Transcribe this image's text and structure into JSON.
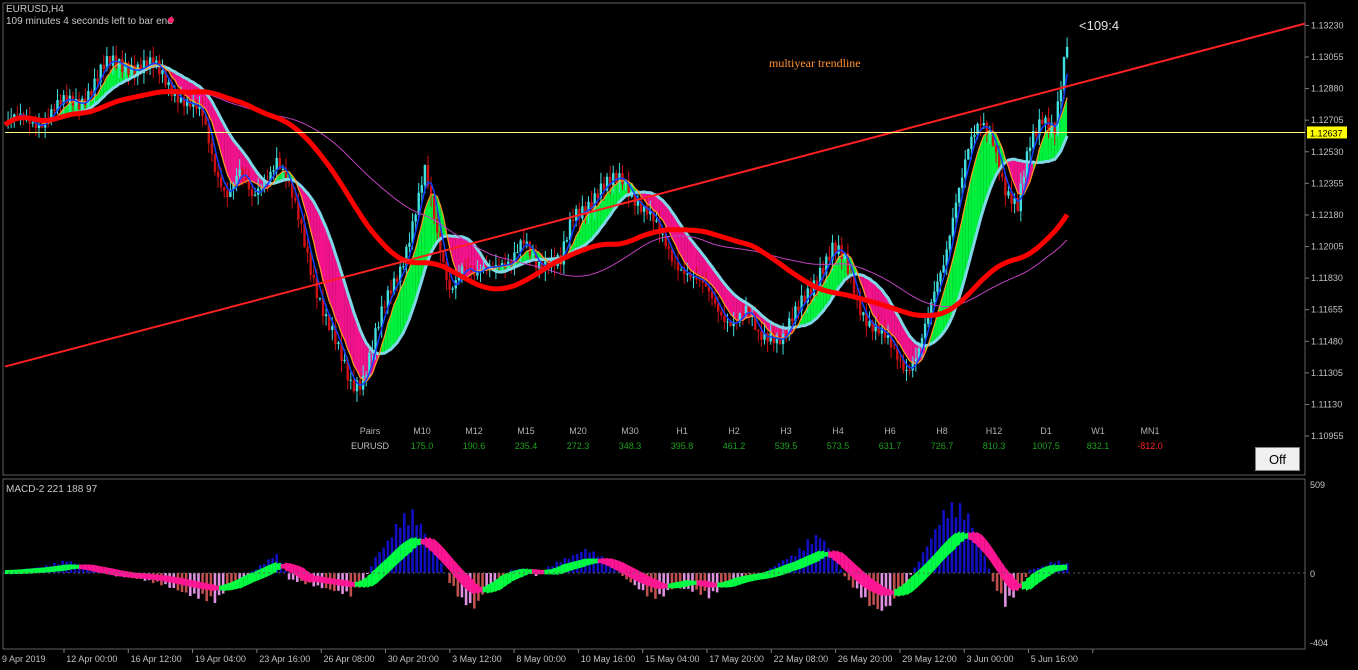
{
  "window": {
    "symbol_tf": "EURUSD,H4",
    "countdown_text": "109 minutes 4 seconds left to bar end",
    "bar_timer": "<109:4"
  },
  "annotation": {
    "trendline_label": "multiyear trendline"
  },
  "price_axis": {
    "ticks": [
      "1.13230",
      "1.13055",
      "1.12880",
      "1.12705",
      "1.12530",
      "1.12355",
      "1.12180",
      "1.12005",
      "1.11830",
      "1.11655",
      "1.11480",
      "1.11305",
      "1.11130",
      "1.10955"
    ],
    "current_price": "1.12637"
  },
  "time_axis": {
    "labels": [
      "9 Apr 2019",
      "12 Apr 00:00",
      "16 Apr 12:00",
      "19 Apr 04:00",
      "23 Apr 16:00",
      "26 Apr 08:00",
      "30 Apr 20:00",
      "3 May 12:00",
      "8 May 00:00",
      "10 May 16:00",
      "15 May 04:00",
      "17 May 20:00",
      "22 May 08:00",
      "26 May 20:00",
      "29 May 12:00",
      "3 Jun 00:00",
      "5 Jun 16:00"
    ]
  },
  "strength_table": {
    "header": [
      "Pairs",
      "M10",
      "M12",
      "M15",
      "M20",
      "M30",
      "H1",
      "H2",
      "H3",
      "H4",
      "H6",
      "H8",
      "H12",
      "D1",
      "W1",
      "MN1"
    ],
    "row_label": "EURUSD",
    "values": [
      "175.0",
      "190.6",
      "235.4",
      "272.3",
      "348.3",
      "395.8",
      "461.2",
      "539.5",
      "573.5",
      "631.7",
      "726.7",
      "810.3",
      "1007.5",
      "832.1",
      "-812.0"
    ]
  },
  "indicator": {
    "title": "MACD-2 221 188 97",
    "scale_top": "509",
    "scale_zero": "0",
    "scale_bottom": "-404"
  },
  "buttons": {
    "off_label": "Off"
  },
  "colors": {
    "background": "#000000",
    "bull_candle": "#40e0e0",
    "bear_candle": "#d01010",
    "bull_cloud": "#00ff40",
    "bear_cloud": "#ff1493",
    "ma_slow": "#ff0000",
    "trendline": "#ff2020",
    "price_line": "#ffff80",
    "macd_pos": "#1010c0",
    "macd_neg": "#c05050",
    "macd_signal_up": "#00ff40",
    "macd_signal_down": "#ff1493"
  },
  "chart_data": {
    "type": "candlestick",
    "symbol": "EURUSD",
    "timeframe": "H4",
    "ylim": [
      1.1085,
      1.1326
    ],
    "current_price": 1.12637,
    "close_path": [
      [
        0,
        1.1268
      ],
      [
        3,
        1.1272
      ],
      [
        6,
        1.1282
      ],
      [
        8,
        1.1298
      ],
      [
        10,
        1.1303
      ],
      [
        12,
        1.1298
      ],
      [
        14,
        1.1287
      ],
      [
        16,
        1.127
      ],
      [
        17,
        1.1245
      ],
      [
        18,
        1.1232
      ],
      [
        19,
        1.124
      ],
      [
        20,
        1.1225
      ],
      [
        21,
        1.124
      ],
      [
        22,
        1.125
      ],
      [
        23,
        1.123
      ],
      [
        24,
        1.121
      ],
      [
        25,
        1.1185
      ],
      [
        26,
        1.116
      ],
      [
        27,
        1.114
      ],
      [
        28,
        1.1125
      ],
      [
        29,
        1.113
      ],
      [
        30,
        1.115
      ],
      [
        31,
        1.117
      ],
      [
        32,
        1.119
      ],
      [
        33,
        1.1215
      ],
      [
        34,
        1.124
      ],
      [
        35,
        1.1205
      ],
      [
        36,
        1.118
      ],
      [
        37,
        1.119
      ],
      [
        38,
        1.118
      ],
      [
        39,
        1.119
      ],
      [
        40,
        1.1195
      ],
      [
        41,
        1.119
      ],
      [
        42,
        1.12
      ],
      [
        43,
        1.1193
      ],
      [
        44,
        1.1195
      ],
      [
        45,
        1.119
      ],
      [
        46,
        1.1215
      ],
      [
        47,
        1.1225
      ],
      [
        48,
        1.1232
      ],
      [
        49,
        1.1233
      ],
      [
        50,
        1.1237
      ],
      [
        51,
        1.123
      ],
      [
        52,
        1.122
      ],
      [
        53,
        1.1205
      ],
      [
        54,
        1.1195
      ],
      [
        55,
        1.119
      ],
      [
        56,
        1.118
      ],
      [
        57,
        1.1172
      ],
      [
        58,
        1.1165
      ],
      [
        59,
        1.116
      ],
      [
        60,
        1.1162
      ],
      [
        61,
        1.115
      ],
      [
        62,
        1.1155
      ],
      [
        63,
        1.115
      ],
      [
        64,
        1.116
      ],
      [
        65,
        1.1175
      ],
      [
        66,
        1.119
      ],
      [
        67,
        1.1198
      ],
      [
        68,
        1.119
      ],
      [
        69,
        1.1172
      ],
      [
        70,
        1.116
      ],
      [
        71,
        1.115
      ],
      [
        72,
        1.114
      ],
      [
        73,
        1.1135
      ],
      [
        74,
        1.1145
      ],
      [
        75,
        1.1165
      ],
      [
        76,
        1.119
      ],
      [
        77,
        1.123
      ],
      [
        78,
        1.1255
      ],
      [
        79,
        1.1265
      ],
      [
        80,
        1.126
      ],
      [
        81,
        1.1235
      ],
      [
        82,
        1.122
      ],
      [
        83,
        1.1255
      ],
      [
        84,
        1.1275
      ],
      [
        85,
        1.1268
      ],
      [
        86,
        1.131
      ]
    ],
    "macd_hist": [
      [
        0,
        10
      ],
      [
        3,
        40
      ],
      [
        5,
        80
      ],
      [
        7,
        30
      ],
      [
        9,
        -20
      ],
      [
        11,
        -40
      ],
      [
        13,
        -80
      ],
      [
        15,
        -140
      ],
      [
        17,
        -180
      ],
      [
        18,
        -100
      ],
      [
        19,
        -60
      ],
      [
        20,
        10
      ],
      [
        22,
        120
      ],
      [
        23,
        -40
      ],
      [
        25,
        -80
      ],
      [
        27,
        -120
      ],
      [
        28,
        -140
      ],
      [
        29,
        -60
      ],
      [
        30,
        100
      ],
      [
        31,
        200
      ],
      [
        32,
        340
      ],
      [
        33,
        380
      ],
      [
        34,
        260
      ],
      [
        35,
        120
      ],
      [
        36,
        -60
      ],
      [
        37,
        -180
      ],
      [
        38,
        -220
      ],
      [
        39,
        -100
      ],
      [
        40,
        -40
      ],
      [
        41,
        20
      ],
      [
        42,
        30
      ],
      [
        43,
        -20
      ],
      [
        44,
        40
      ],
      [
        45,
        80
      ],
      [
        46,
        110
      ],
      [
        47,
        150
      ],
      [
        48,
        120
      ],
      [
        49,
        60
      ],
      [
        50,
        -20
      ],
      [
        51,
        -80
      ],
      [
        52,
        -140
      ],
      [
        53,
        -160
      ],
      [
        54,
        -100
      ],
      [
        55,
        -100
      ],
      [
        56,
        -120
      ],
      [
        57,
        -150
      ],
      [
        58,
        -100
      ],
      [
        59,
        -60
      ],
      [
        60,
        -40
      ],
      [
        61,
        -20
      ],
      [
        62,
        30
      ],
      [
        63,
        80
      ],
      [
        64,
        120
      ],
      [
        65,
        200
      ],
      [
        66,
        240
      ],
      [
        67,
        120
      ],
      [
        68,
        -20
      ],
      [
        69,
        -120
      ],
      [
        70,
        -200
      ],
      [
        71,
        -240
      ],
      [
        72,
        -180
      ],
      [
        73,
        -60
      ],
      [
        74,
        80
      ],
      [
        75,
        220
      ],
      [
        76,
        380
      ],
      [
        77,
        440
      ],
      [
        78,
        360
      ],
      [
        79,
        200
      ],
      [
        80,
        -60
      ],
      [
        81,
        -200
      ],
      [
        82,
        -120
      ],
      [
        83,
        20
      ],
      [
        84,
        40
      ],
      [
        85,
        80
      ],
      [
        86,
        60
      ]
    ]
  }
}
